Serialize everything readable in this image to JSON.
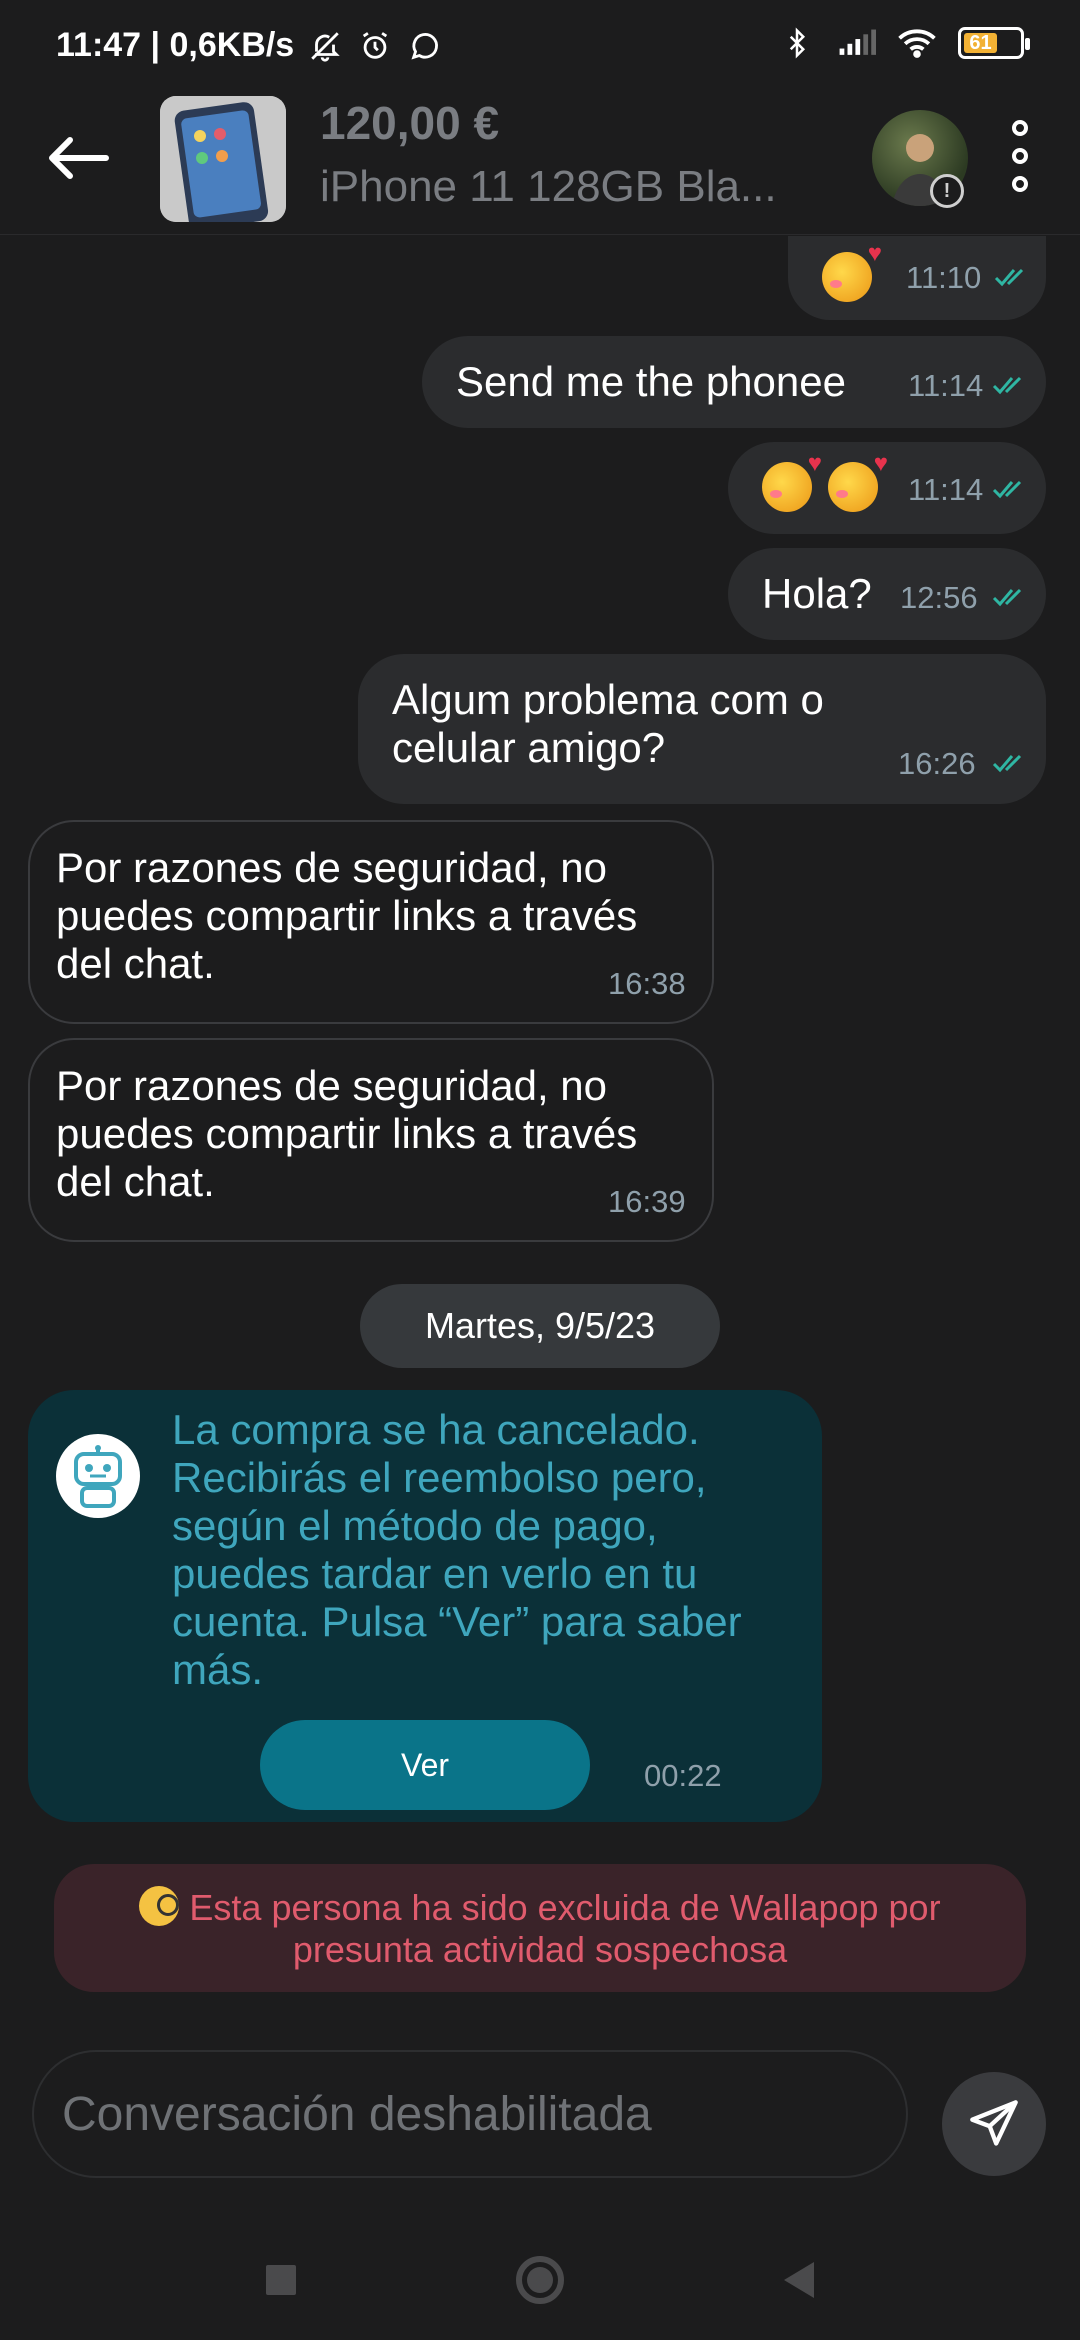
{
  "status_bar": {
    "time_speed": "11:47 | 0,6KB/s",
    "battery": "61",
    "battery_color": "#f2b134"
  },
  "header": {
    "price": "120,00 €",
    "title": "iPhone 11 128GB Bla..."
  },
  "messages": [
    {
      "text": "",
      "time": "11:10",
      "emojis": 1
    },
    {
      "text": "Send me the phonee",
      "time": "11:14"
    },
    {
      "text": "",
      "time": "11:14",
      "emojis": 2
    },
    {
      "text": "Hola?",
      "time": "12:56"
    },
    {
      "text": "Algum problema com o celular amigo?",
      "time": "16:26"
    }
  ],
  "incoming": [
    {
      "text": "Por razones de seguridad, no puedes compartir links a través del chat.",
      "time": "16:38"
    },
    {
      "text": "Por razones de seguridad, no puedes compartir links a través del chat.",
      "time": "16:39"
    }
  ],
  "date_separator": "Martes, 9/5/23",
  "bot": {
    "text": "La compra se ha cancelado. Recibirás el reembolso pero, según el método de pago, puedes tardar en verlo en tu cuenta. Pulsa “Ver” para saber más.",
    "button": "Ver",
    "time": "00:22"
  },
  "warning": {
    "text": "Esta persona ha sido excluida de Wallapop por presunta actividad sospechosa"
  },
  "input": {
    "placeholder": "Conversación deshabilitada"
  },
  "colors": {
    "accent": "#0a7489",
    "check": "#2fb6a3",
    "warning": "#e05b6d"
  }
}
